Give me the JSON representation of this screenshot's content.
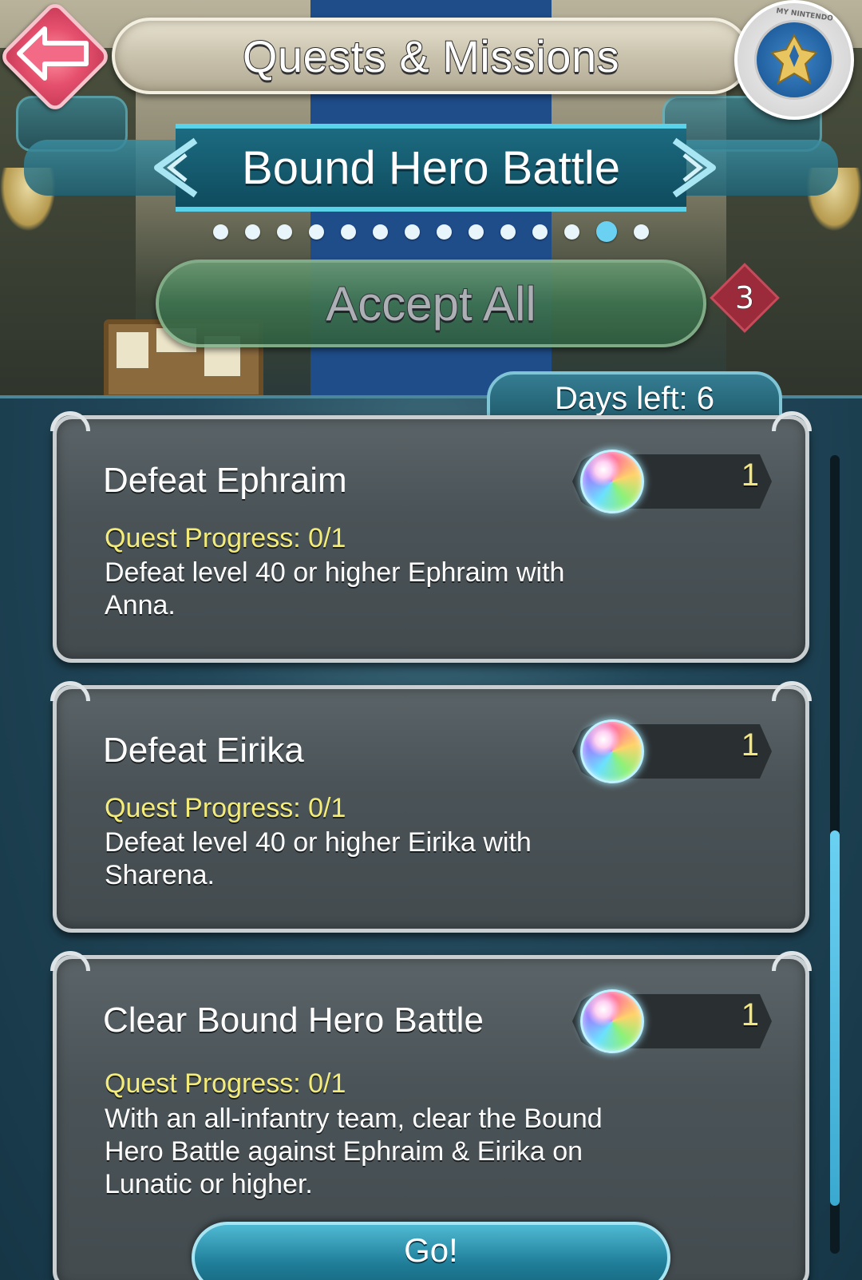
{
  "header": {
    "title": "Quests & Missions",
    "back_icon": "back-arrow-icon",
    "badge_label": "MY NINTENDO"
  },
  "section": {
    "title": "Bound Hero Battle",
    "page_count": 14,
    "active_page": 13
  },
  "accept_all": {
    "label": "Accept All",
    "count": "3"
  },
  "days_left": "Days left: 6",
  "quests": [
    {
      "title": "Defeat Ephraim",
      "reward_icon": "orb-icon",
      "reward_count": "1",
      "progress": "Quest Progress: 0/1",
      "description": "Defeat level 40 or higher Ephraim with Anna."
    },
    {
      "title": "Defeat Eirika",
      "reward_icon": "orb-icon",
      "reward_count": "1",
      "progress": "Quest Progress: 0/1",
      "description": "Defeat level 40 or higher Eirika with Sharena."
    },
    {
      "title": "Clear Bound Hero Battle",
      "reward_icon": "orb-icon",
      "reward_count": "1",
      "progress": "Quest Progress: 0/1",
      "description": "With an all-infantry team, clear the Bound Hero Battle against Ephraim & Eirika on Lunatic or higher."
    }
  ],
  "go_button": {
    "label": "Go!"
  },
  "scroll": {
    "position_fraction": 0.47,
    "visible_fraction": 0.47
  },
  "colors": {
    "accent": "#6bd1f2",
    "progress_text": "#f4ec7a",
    "reward_count": "#f2e680",
    "back_button": "#e5506d",
    "accept_button": "#3f7350"
  }
}
